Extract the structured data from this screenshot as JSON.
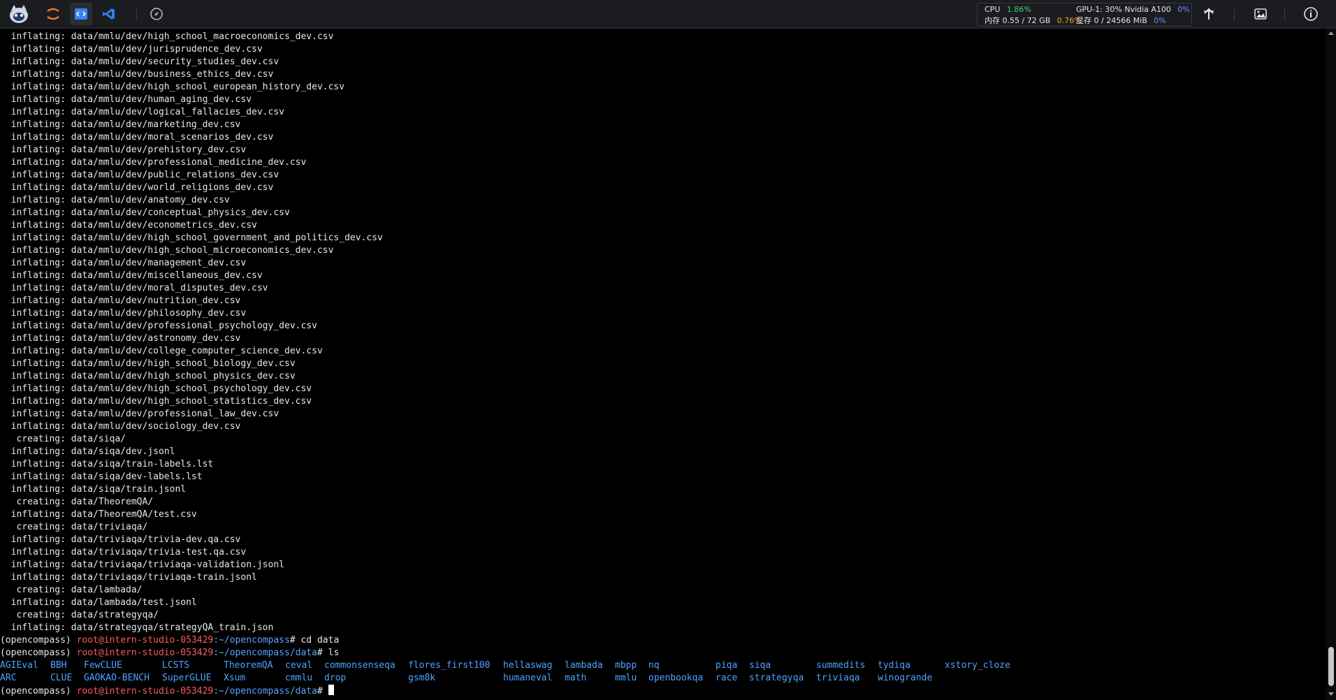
{
  "top_bar": {
    "stats": {
      "cpu_label": "CPU",
      "cpu_value": "1.86%",
      "mem_label": "内存 0.55 / 72 GB",
      "mem_value": "0.76%",
      "gpu_label": "GPU-1: 30% Nvidia A100",
      "gpu_value": "0%",
      "vram_label": "显存 0 / 24566 MiB",
      "vram_value": "0%"
    }
  },
  "terminal": {
    "output_lines": [
      "  inflating: data/mmlu/dev/high_school_macroeconomics_dev.csv",
      "  inflating: data/mmlu/dev/jurisprudence_dev.csv",
      "  inflating: data/mmlu/dev/security_studies_dev.csv",
      "  inflating: data/mmlu/dev/business_ethics_dev.csv",
      "  inflating: data/mmlu/dev/high_school_european_history_dev.csv",
      "  inflating: data/mmlu/dev/human_aging_dev.csv",
      "  inflating: data/mmlu/dev/logical_fallacies_dev.csv",
      "  inflating: data/mmlu/dev/marketing_dev.csv",
      "  inflating: data/mmlu/dev/moral_scenarios_dev.csv",
      "  inflating: data/mmlu/dev/prehistory_dev.csv",
      "  inflating: data/mmlu/dev/professional_medicine_dev.csv",
      "  inflating: data/mmlu/dev/public_relations_dev.csv",
      "  inflating: data/mmlu/dev/world_religions_dev.csv",
      "  inflating: data/mmlu/dev/anatomy_dev.csv",
      "  inflating: data/mmlu/dev/conceptual_physics_dev.csv",
      "  inflating: data/mmlu/dev/econometrics_dev.csv",
      "  inflating: data/mmlu/dev/high_school_government_and_politics_dev.csv",
      "  inflating: data/mmlu/dev/high_school_microeconomics_dev.csv",
      "  inflating: data/mmlu/dev/management_dev.csv",
      "  inflating: data/mmlu/dev/miscellaneous_dev.csv",
      "  inflating: data/mmlu/dev/moral_disputes_dev.csv",
      "  inflating: data/mmlu/dev/nutrition_dev.csv",
      "  inflating: data/mmlu/dev/philosophy_dev.csv",
      "  inflating: data/mmlu/dev/professional_psychology_dev.csv",
      "  inflating: data/mmlu/dev/astronomy_dev.csv",
      "  inflating: data/mmlu/dev/college_computer_science_dev.csv",
      "  inflating: data/mmlu/dev/high_school_biology_dev.csv",
      "  inflating: data/mmlu/dev/high_school_physics_dev.csv",
      "  inflating: data/mmlu/dev/high_school_psychology_dev.csv",
      "  inflating: data/mmlu/dev/high_school_statistics_dev.csv",
      "  inflating: data/mmlu/dev/professional_law_dev.csv",
      "  inflating: data/mmlu/dev/sociology_dev.csv",
      "   creating: data/siqa/",
      "  inflating: data/siqa/dev.jsonl",
      "  inflating: data/siqa/train-labels.lst",
      "  inflating: data/siqa/dev-labels.lst",
      "  inflating: data/siqa/train.jsonl",
      "   creating: data/TheoremQA/",
      "  inflating: data/TheoremQA/test.csv",
      "   creating: data/triviaqa/",
      "  inflating: data/triviaqa/trivia-dev.qa.csv",
      "  inflating: data/triviaqa/trivia-test.qa.csv",
      "  inflating: data/triviaqa/triviaqa-validation.jsonl",
      "  inflating: data/triviaqa/triviaqa-train.jsonl",
      "   creating: data/lambada/",
      "  inflating: data/lambada/test.jsonl",
      "   creating: data/strategyqa/",
      "  inflating: data/strategyqa/strategyQA_train.json"
    ],
    "prompts": [
      {
        "env": "(opencompass) ",
        "user": "root@intern-studio-053429",
        "path": ":~/opencompass",
        "command": "# cd data"
      },
      {
        "env": "(opencompass) ",
        "user": "root@intern-studio-053429",
        "path": ":~/opencompass/data",
        "command": "# ls"
      }
    ],
    "ls_row1": [
      {
        "name": "AGIEval",
        "col": 0
      },
      {
        "name": "BBH",
        "col": 9
      },
      {
        "name": "FewCLUE",
        "col": 15
      },
      {
        "name": "LCSTS",
        "col": 29
      },
      {
        "name": "TheoremQA",
        "col": 40
      },
      {
        "name": "ceval",
        "col": 51
      },
      {
        "name": "commonsenseqa",
        "col": 58
      },
      {
        "name": "flores_first100",
        "col": 73
      },
      {
        "name": "hellaswag",
        "col": 90
      },
      {
        "name": "lambada",
        "col": 101
      },
      {
        "name": "mbpp",
        "col": 110
      },
      {
        "name": "nq",
        "col": 116
      },
      {
        "name": "piqa",
        "col": 128
      },
      {
        "name": "siqa",
        "col": 134
      },
      {
        "name": "summedits",
        "col": 146
      },
      {
        "name": "tydiqa",
        "col": 157
      },
      {
        "name": "xstory_cloze",
        "col": 169
      }
    ],
    "ls_row2": [
      {
        "name": "ARC",
        "col": 0
      },
      {
        "name": "CLUE",
        "col": 9
      },
      {
        "name": "GAOKAO-BENCH",
        "col": 15
      },
      {
        "name": "SuperGLUE",
        "col": 29
      },
      {
        "name": "Xsum",
        "col": 40
      },
      {
        "name": "cmmlu",
        "col": 51
      },
      {
        "name": "drop",
        "col": 58
      },
      {
        "name": "gsm8k",
        "col": 73
      },
      {
        "name": "humaneval",
        "col": 90
      },
      {
        "name": "math",
        "col": 101
      },
      {
        "name": "mmlu",
        "col": 110
      },
      {
        "name": "openbookqa",
        "col": 116
      },
      {
        "name": "race",
        "col": 128
      },
      {
        "name": "strategyqa",
        "col": 134
      },
      {
        "name": "triviaqa",
        "col": 146
      },
      {
        "name": "winogrande",
        "col": 157
      }
    ],
    "final_prompt": {
      "env": "(opencompass) ",
      "user": "root@intern-studio-053429",
      "path": ":~/opencompass/data",
      "command": "# "
    }
  }
}
